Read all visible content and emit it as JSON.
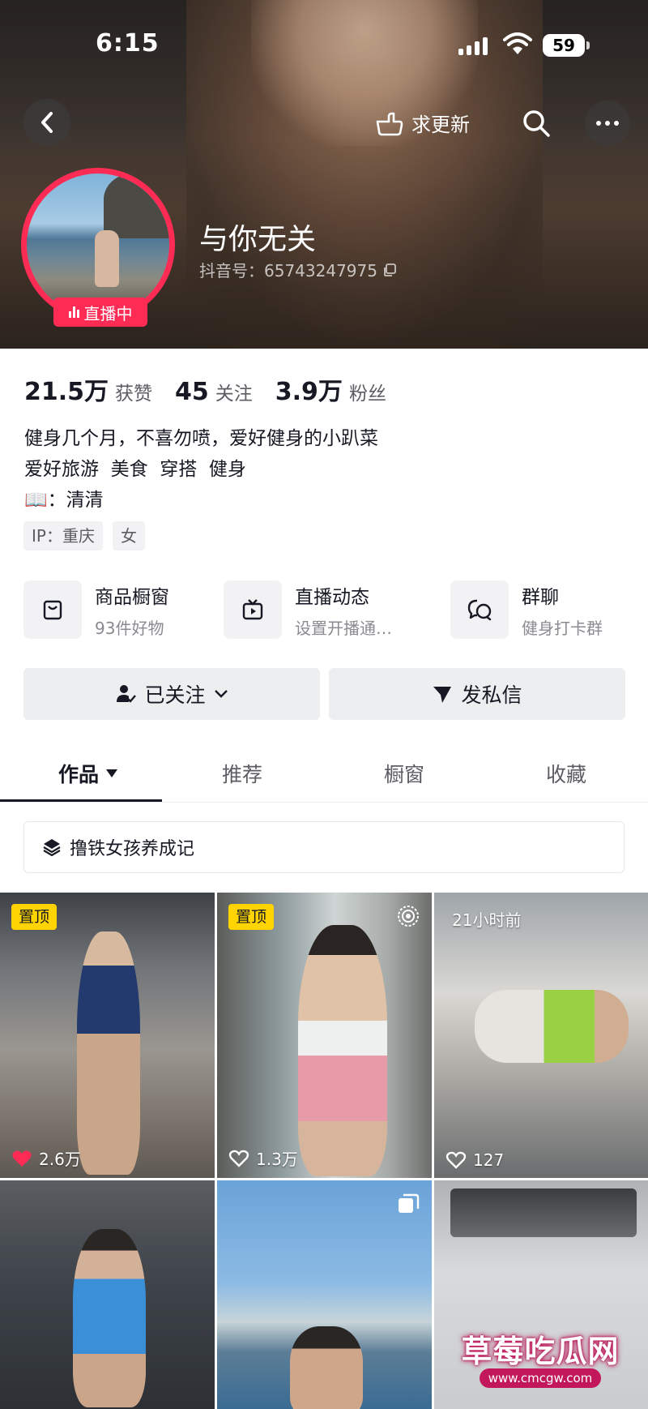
{
  "status_bar": {
    "time": "6:15",
    "battery": "59"
  },
  "header": {
    "ask_update_label": "求更新"
  },
  "profile": {
    "live_label": "直播中",
    "nickname": "与你无关",
    "douyin_id": "抖音号：65743247975"
  },
  "stats": [
    {
      "value": "21.5万",
      "label": "获赞"
    },
    {
      "value": "45",
      "label": "关注"
    },
    {
      "value": "3.9万",
      "label": "粉丝"
    }
  ],
  "bio": {
    "line1": "健身几个月，不喜勿喷，爱好健身的小趴菜",
    "line2": "爱好旅游  美食  穿搭  健身",
    "line3": "📖：清清"
  },
  "tags": {
    "ip": "IP：重庆",
    "gender": "女"
  },
  "features": [
    {
      "title": "商品橱窗",
      "subtitle": "93件好物",
      "icon": "shopping-bag-icon"
    },
    {
      "title": "直播动态",
      "subtitle": "设置开播通…",
      "icon": "tv-icon"
    },
    {
      "title": "群聊",
      "subtitle": "健身打卡群",
      "icon": "chat-bubbles-icon"
    }
  ],
  "actions": {
    "follow_label": "已关注",
    "message_label": "发私信"
  },
  "tabs": [
    "作品",
    "推荐",
    "橱窗",
    "收藏"
  ],
  "collection": {
    "label": "撸铁女孩养成记"
  },
  "videos": [
    {
      "badge": "置顶",
      "likes": "2.6万",
      "liked": true
    },
    {
      "badge": "置顶",
      "likes": "1.3万",
      "liked": false
    },
    {
      "time_tag": "21小时前",
      "likes": "127",
      "liked": false
    },
    {},
    {},
    {}
  ],
  "watermark": {
    "title": "草莓吃瓜网",
    "url": "www.cmcgw.com"
  },
  "colors": {
    "accent": "#fe2c55",
    "pin": "#ffd400",
    "text": "#161823"
  }
}
